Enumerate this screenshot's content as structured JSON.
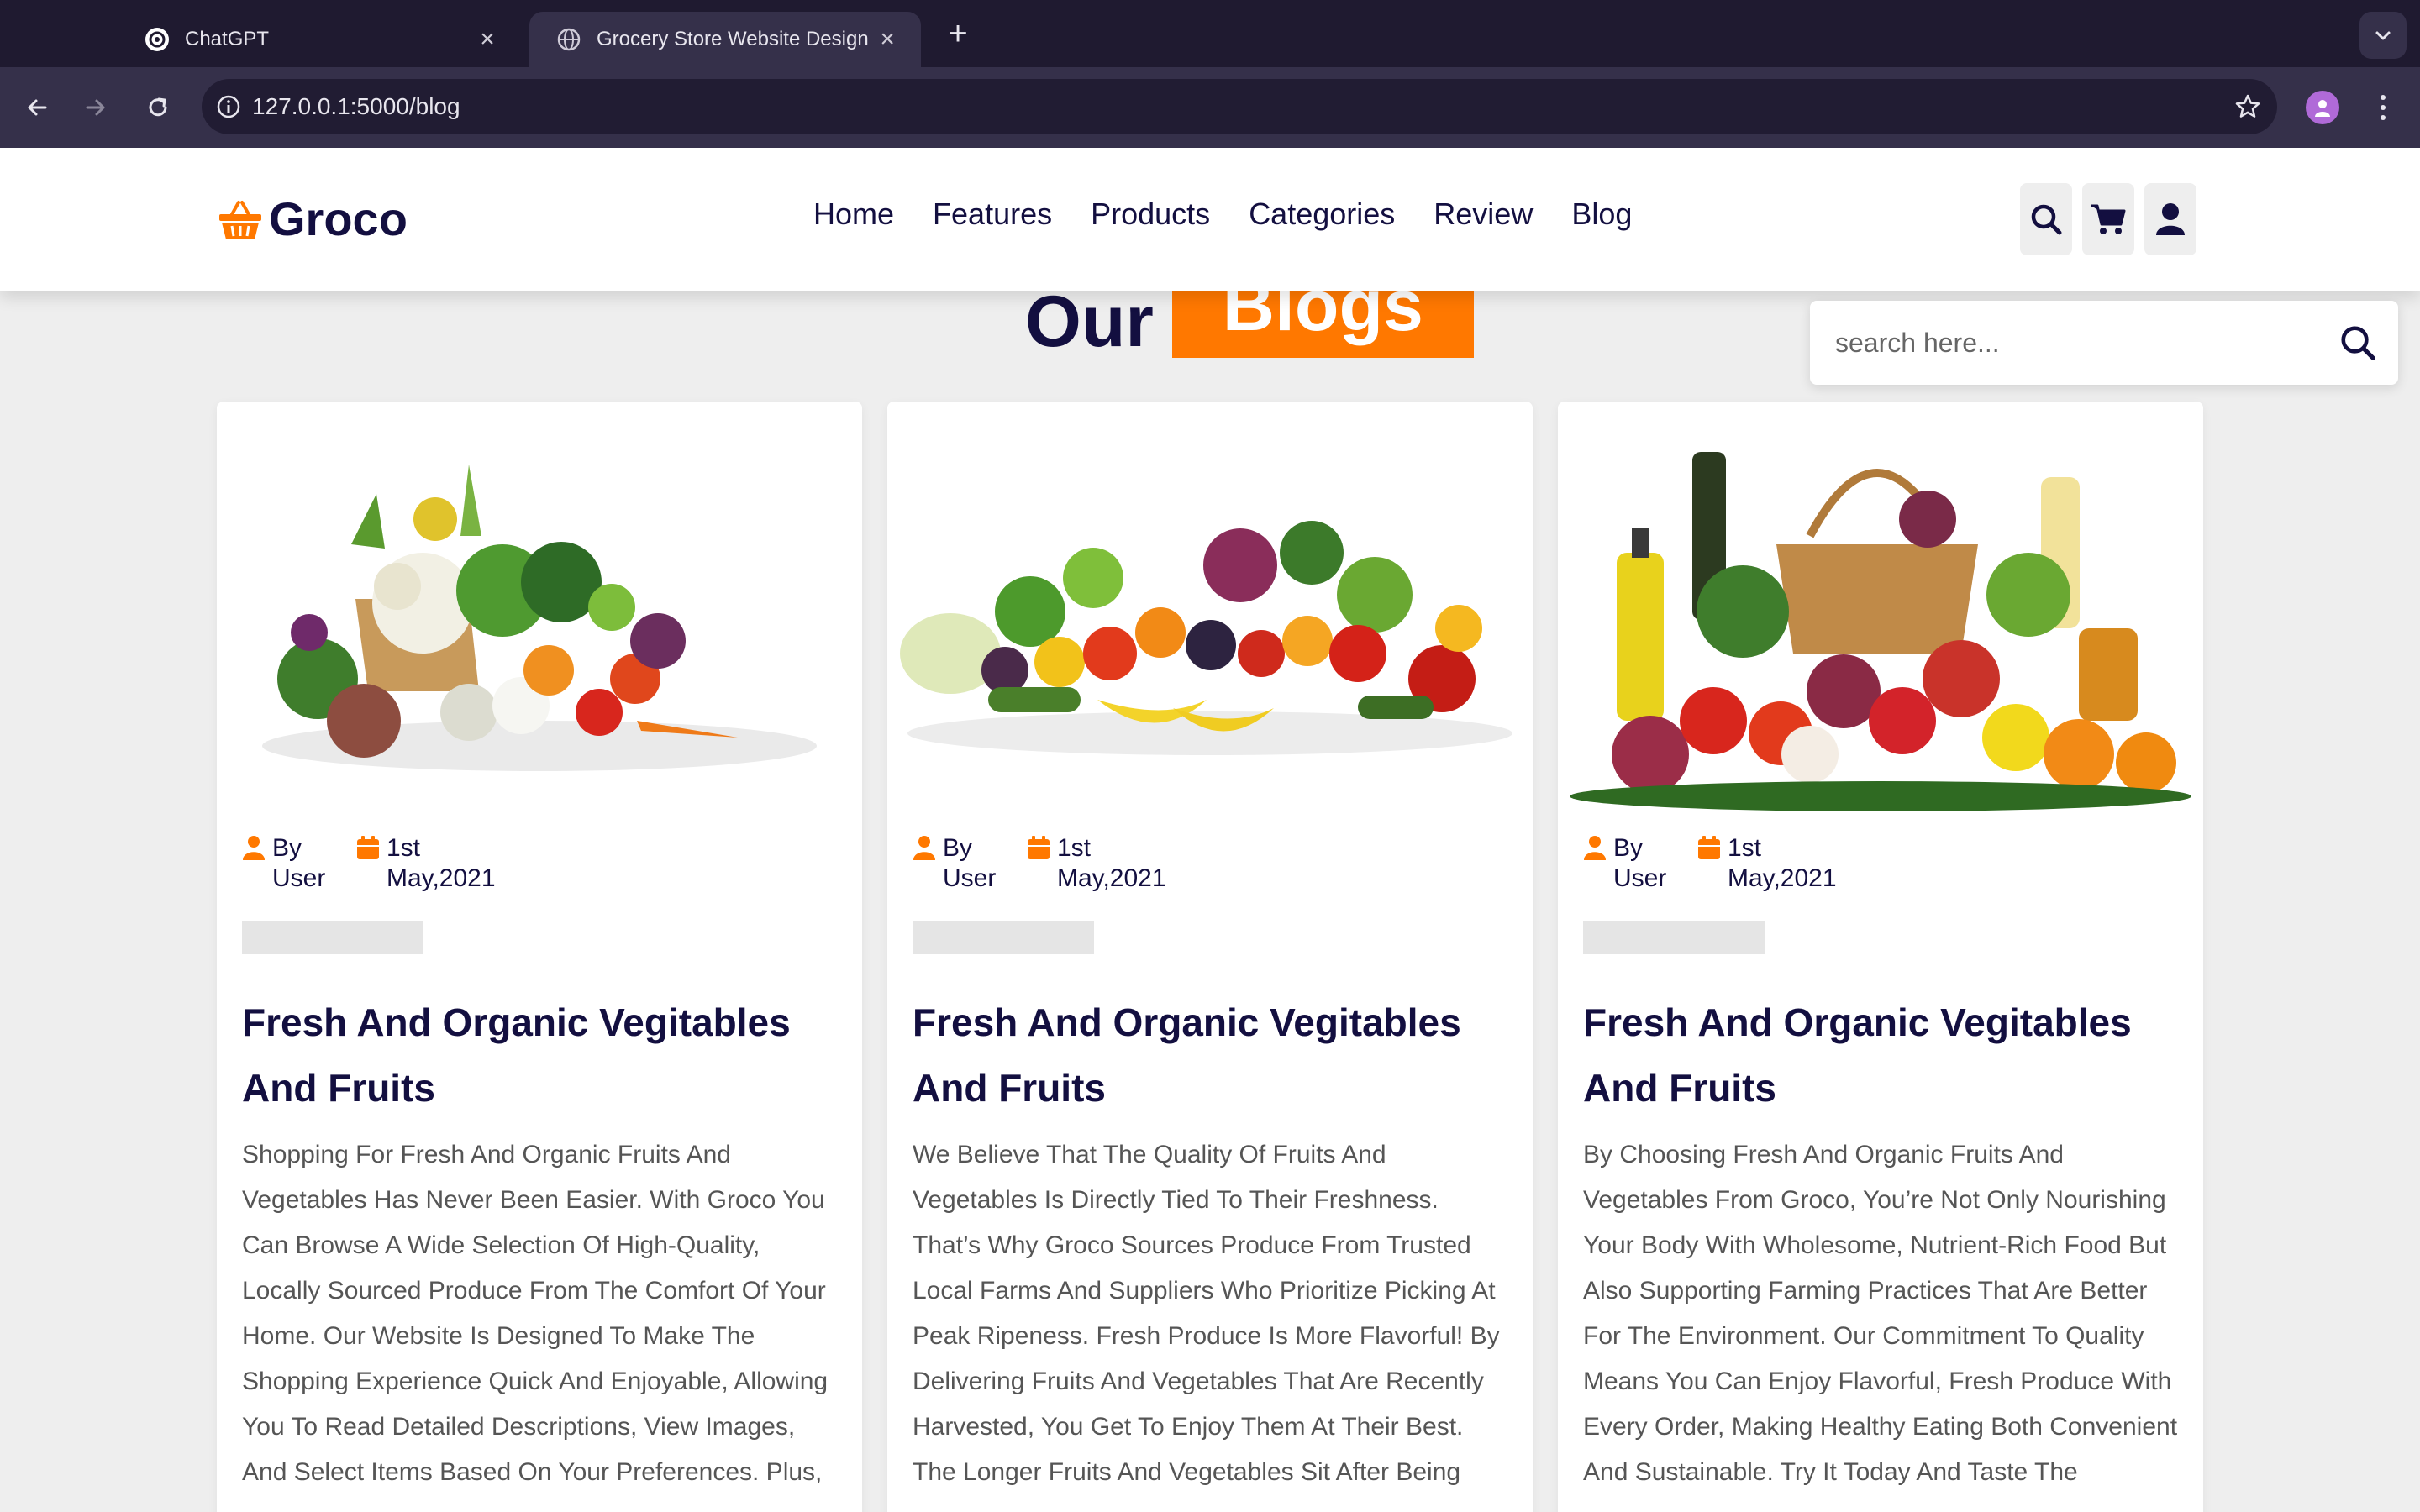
{
  "browser": {
    "tabs": [
      {
        "title": "ChatGPT",
        "icon": "chatgpt-icon",
        "active": false
      },
      {
        "title": "Grocery Store Website Design",
        "icon": "globe-icon",
        "active": true
      }
    ],
    "url": "127.0.0.1:5000/blog"
  },
  "header": {
    "logo": "Groco",
    "nav": [
      "Home",
      "Features",
      "Products",
      "Categories",
      "Review",
      "Blog"
    ],
    "icons": [
      "search-icon",
      "cart-icon",
      "user-icon"
    ]
  },
  "search": {
    "placeholder": "search here..."
  },
  "section": {
    "heading_first": "Our",
    "heading_accent": "Blogs"
  },
  "colors": {
    "accent": "#ff7800",
    "navy": "#130f40",
    "chrome": "#35304a",
    "tabbar": "#1f1a30",
    "page_bg": "#eeeeee"
  },
  "blogs": [
    {
      "author_line1": "By",
      "author_line2": "User",
      "date_line1": "1st",
      "date_line2": "May,2021",
      "title": "Fresh And Organic Vegitables And Fruits",
      "text": "Shopping For Fresh And Organic Fruits And Vegetables Has Never Been Easier. With Groco You Can Browse A Wide Selection Of High-Quality, Locally Sourced Produce From The Comfort Of Your Home. Our Website Is Designed To Make The Shopping Experience Quick And Enjoyable, Allowing You To Read Detailed Descriptions, View Images, And Select Items Based On Your Preferences. Plus,"
    },
    {
      "author_line1": "By",
      "author_line2": "User",
      "date_line1": "1st",
      "date_line2": "May,2021",
      "title": "Fresh And Organic Vegitables And Fruits",
      "text": "We Believe That The Quality Of Fruits And Vegetables Is Directly Tied To Their Freshness. That’s Why Groco Sources Produce From Trusted Local Farms And Suppliers Who Prioritize Picking At Peak Ripeness. Fresh Produce Is More Flavorful! By Delivering Fruits And Vegetables That Are Recently Harvested, You Get To Enjoy Them At Their Best. The Longer Fruits And Vegetables Sit After Being"
    },
    {
      "author_line1": "By",
      "author_line2": "User",
      "date_line1": "1st",
      "date_line2": "May,2021",
      "title": "Fresh And Organic Vegitables And Fruits",
      "text": "By Choosing Fresh And Organic Fruits And Vegetables From Groco, You’re Not Only Nourishing Your Body With Wholesome, Nutrient-Rich Food But Also Supporting Farming Practices That Are Better For The Environment. Our Commitment To Quality Means You Can Enjoy Flavorful, Fresh Produce With Every Order, Making Healthy Eating Both Convenient And Sustainable. Try It Today And Taste The"
    }
  ]
}
